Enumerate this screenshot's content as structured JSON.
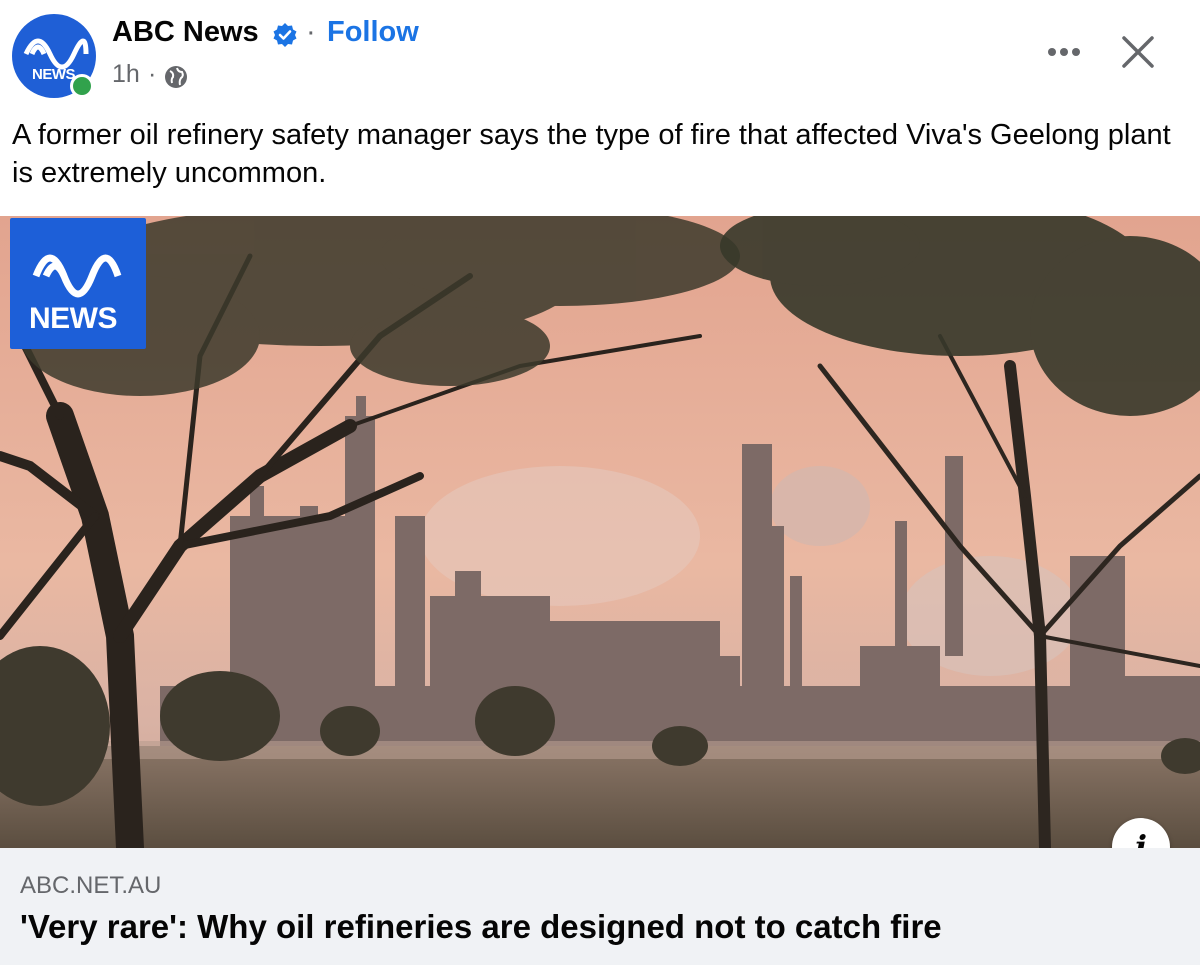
{
  "header": {
    "page_name": "ABC News",
    "avatar_text": "NEWS",
    "follow_separator": "·",
    "follow_label": "Follow",
    "timestamp": "1h",
    "meta_separator": "·",
    "icons": {
      "verified": "verified-badge-icon",
      "globe": "globe-icon",
      "more": "more-options-icon",
      "close": "close-icon"
    }
  },
  "post": {
    "caption": "A former oil refinery safety manager says the type of fire that affected Viva's Geelong plant is extremely uncommon."
  },
  "link_preview": {
    "image_badge_text": "NEWS",
    "info_icon": "info-icon",
    "info_glyph": "i",
    "domain": "ABC.NET.AU",
    "title": "'Very rare': Why oil refineries are designed not to catch fire"
  },
  "colors": {
    "brand_blue": "#1d5fd8",
    "follow_blue": "#1b74e4",
    "online_green": "#31a24c",
    "footer_bg": "#f0f2f5",
    "secondary_text": "#65676b"
  }
}
